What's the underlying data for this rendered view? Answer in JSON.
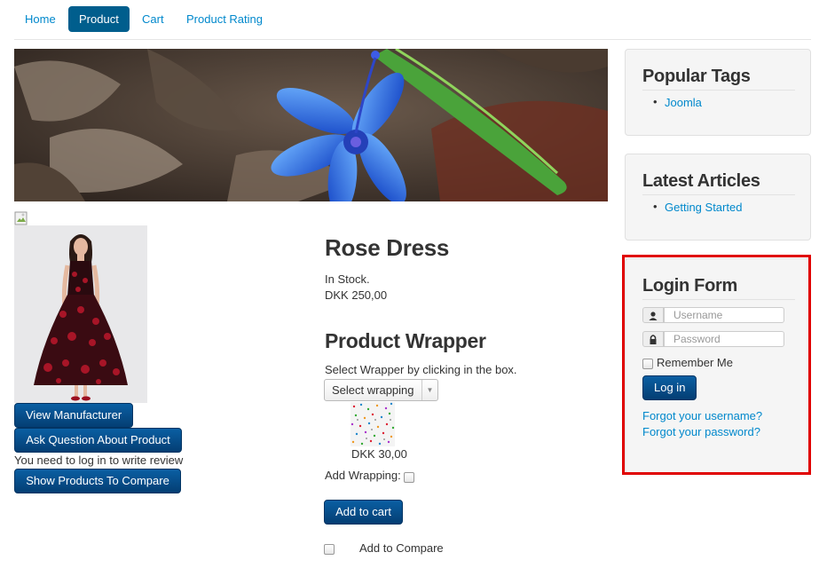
{
  "nav": {
    "items": [
      {
        "label": "Home",
        "active": false
      },
      {
        "label": "Product",
        "active": true
      },
      {
        "label": "Cart",
        "active": false
      },
      {
        "label": "Product Rating",
        "active": false
      }
    ]
  },
  "product": {
    "title": "Rose Dress",
    "stock": "In Stock.",
    "price": "DKK 250,00",
    "buttons": {
      "manufacturer": "View Manufacturer",
      "ask": "Ask Question About Product",
      "compare": "Show Products To Compare"
    },
    "review_notice": "You need to log in to write review",
    "wrapper": {
      "title": "Product Wrapper",
      "instruction": "Select Wrapper by clicking in the box.",
      "select_value": "Select wrapping",
      "price": "DKK 30,00",
      "add_label": "Add Wrapping:"
    },
    "add_to_cart": "Add to cart",
    "add_to_compare": "Add to Compare"
  },
  "sidebar": {
    "popular_tags": {
      "title": "Popular Tags",
      "items": [
        "Joomla"
      ]
    },
    "latest_articles": {
      "title": "Latest Articles",
      "items": [
        "Getting Started"
      ]
    },
    "login": {
      "title": "Login Form",
      "username_placeholder": "Username",
      "password_placeholder": "Password",
      "remember": "Remember Me",
      "submit": "Log in",
      "forgot_username": "Forgot your username?",
      "forgot_password": "Forgot your password?"
    }
  },
  "colors": {
    "link": "#0088cc",
    "primary": "#005e8d",
    "highlight_border": "#e00000"
  }
}
